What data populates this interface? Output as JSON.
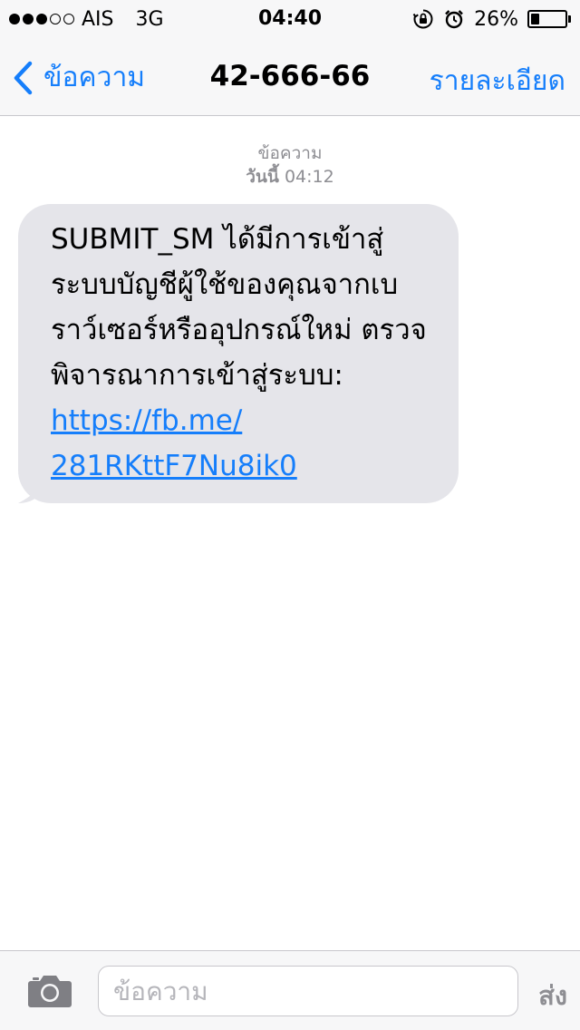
{
  "status_bar": {
    "signal_bars_filled": 3,
    "signal_bars_total": 5,
    "carrier": "AIS",
    "network": "3G",
    "time": "04:40",
    "battery_percent_text": "26%",
    "battery_level": 0.26,
    "icons": [
      "rotation-lock-icon",
      "alarm-clock-icon",
      "battery-icon"
    ]
  },
  "nav": {
    "back_label": "ข้อความ",
    "title": "42-666-66",
    "details_label": "รายละเอียด"
  },
  "conversation": {
    "header_label": "ข้อความ",
    "header_day": "วันนี้",
    "header_time": "04:12",
    "messages": [
      {
        "direction": "incoming",
        "text": "SUBMIT_SM ได้มีการเข้าสู่\nระบบบัญชีผู้ใช้ของคุณจากเบ\nราว์เซอร์หรืออุปกรณ์ใหม่ ตรวจ\nพิจารณาการเข้าสู่ระบบ:",
        "link_display": "https://fb.me/\n281RKttF7Nu8ik0",
        "link_url": "https://fb.me/281RKttF7Nu8ik0"
      }
    ]
  },
  "input_bar": {
    "placeholder": "ข้อความ",
    "send_label": "ส่ง"
  },
  "colors": {
    "accent": "#157efb",
    "bubble_incoming": "#e5e5ea",
    "bar_background": "#f7f7f8",
    "muted_text": "#8e8e93"
  }
}
